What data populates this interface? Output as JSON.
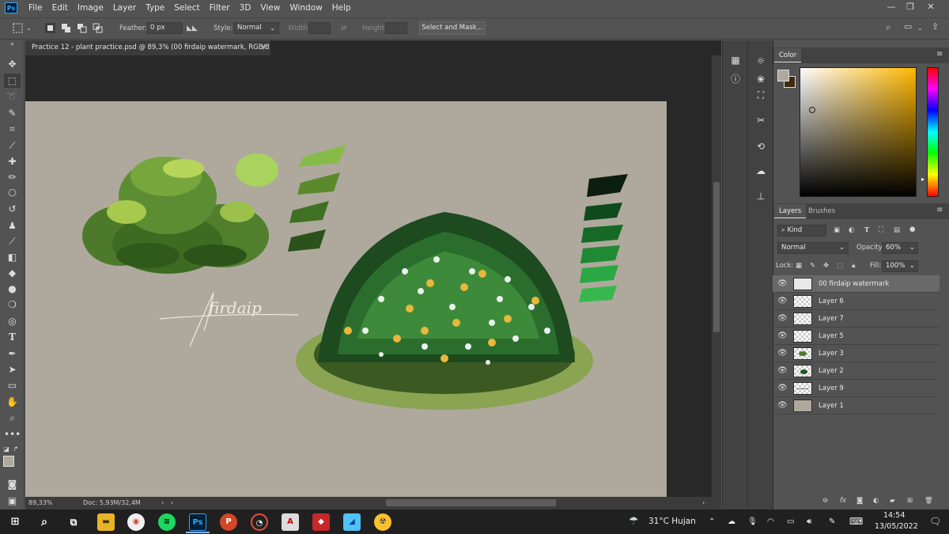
{
  "app": {
    "logo": "Ps",
    "accent": "#31a8ff"
  },
  "menu": [
    "File",
    "Edit",
    "Image",
    "Layer",
    "Type",
    "Select",
    "Filter",
    "3D",
    "View",
    "Window",
    "Help"
  ],
  "options": {
    "feather_label": "Feather:",
    "feather_value": "0 px",
    "style_label": "Style:",
    "style_value": "Normal",
    "width_label": "Width:",
    "height_label": "Height:",
    "select_mask": "Select and Mask..."
  },
  "document": {
    "tab_title": "Practice 12 - plant practice.psd @ 89,3% (00 firdaip watermark, RGB/8",
    "zoom": "89,33%",
    "doc_info": "Doc: 5,93M/32,4M",
    "canvas_color": "#aea99c"
  },
  "artwork": {
    "signature": "firdaip",
    "palette_light": [
      "#a9d35f",
      "#86bb4a",
      "#5b8a2c",
      "#3f7023",
      "#2b521a"
    ],
    "palette_dark": [
      "#0c1e10",
      "#0f4a1c",
      "#166a26",
      "#1f8a33",
      "#2aa843",
      "#37b84e"
    ]
  },
  "panels": {
    "color_tab": "Color",
    "layers_tab": "Layers",
    "brushes_tab": "Brushes",
    "kind_label": "Kind",
    "blend_mode": "Normal",
    "opacity_label": "Opacity:",
    "opacity_value": "60%",
    "lock_label": "Lock:",
    "fill_label": "Fill:",
    "fill_value": "100%",
    "fg_color": "#aea99c",
    "bg_color": "#3d2a10"
  },
  "layers": [
    {
      "name": "00 firdaip watermark",
      "active": true
    },
    {
      "name": "Layer 6",
      "active": false
    },
    {
      "name": "Layer 7",
      "active": false
    },
    {
      "name": "Layer 5",
      "active": false
    },
    {
      "name": "Layer 3",
      "active": false
    },
    {
      "name": "Layer 2",
      "active": false
    },
    {
      "name": "Layer 9",
      "active": false
    },
    {
      "name": "Layer 1",
      "active": false
    }
  ],
  "taskbar": {
    "weather": "31°C  Hujan",
    "time": "14:54",
    "date": "13/05/2022"
  }
}
